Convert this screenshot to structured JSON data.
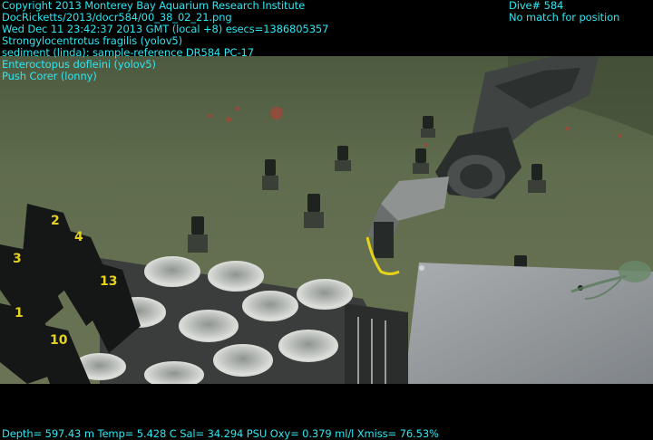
{
  "overlay": {
    "lines_left": [
      "Copyright 2013 Monterey Bay Aquarium Research Institute",
      "DocRicketts/2013/docr584/00_38_02_21.png",
      "Wed Dec 11 23:42:37 2013 GMT (local +8)  esecs=1386805357",
      "Strongylocentrotus fragilis (yolov5)",
      "sediment (linda): sample-reference DR584 PC-17",
      "Enteroctopus dofleini (yolov5)",
      "Push Corer (lonny)"
    ],
    "dive_label": "Dive# 584",
    "position_status": "No match for position",
    "telemetry": "Depth= 597.43 m  Temp= 5.428 C  Sal= 34.294 PSU  Oxy= 0.379 ml/l  Xmiss= 76.53%"
  },
  "core_tube_numbers": [
    "2",
    "4",
    "3",
    "13",
    "1",
    "10"
  ],
  "colors": {
    "overlay_text": "#2ee6f0",
    "seafloor": "#5e6b4c",
    "frame": "#000000"
  }
}
